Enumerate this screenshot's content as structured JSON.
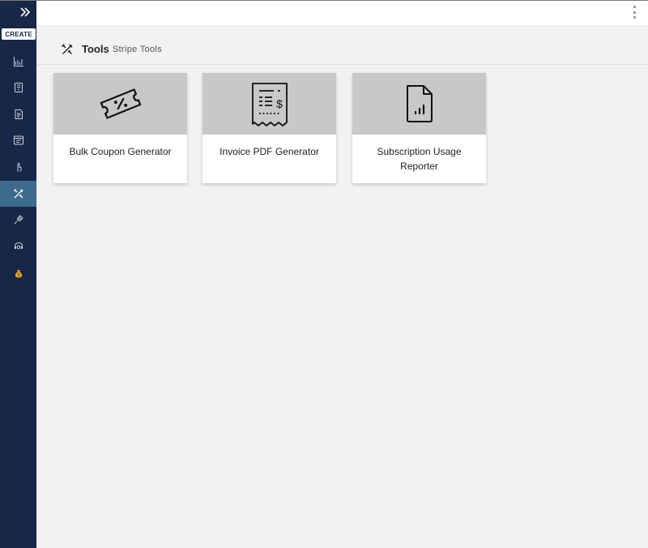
{
  "sidebar": {
    "create_label": "CREATE",
    "items": [
      {
        "icon": "chart-icon"
      },
      {
        "icon": "book-icon"
      },
      {
        "icon": "invoice-doc-icon"
      },
      {
        "icon": "browser-window-icon"
      },
      {
        "icon": "hand-pointer-icon"
      },
      {
        "icon": "tools-icon",
        "active": true
      },
      {
        "icon": "plug-icon"
      },
      {
        "icon": "support-headset-icon"
      },
      {
        "icon": "money-bag-icon"
      }
    ]
  },
  "header": {
    "title": "Tools",
    "subtitle": "Stripe Tools",
    "icon": "tools-icon"
  },
  "cards": [
    {
      "label": "Bulk Coupon Generator",
      "icon": "coupon-ticket-icon"
    },
    {
      "label": "Invoice PDF Generator",
      "icon": "receipt-icon"
    },
    {
      "label": "Subscription Usage Reporter",
      "icon": "document-chart-icon"
    }
  ],
  "colors": {
    "sidebar_bg": "#172747",
    "active_item_bg": "#3d6b8c",
    "page_bg": "#f2f2f4",
    "card_image_bg": "#c8c8c8"
  }
}
